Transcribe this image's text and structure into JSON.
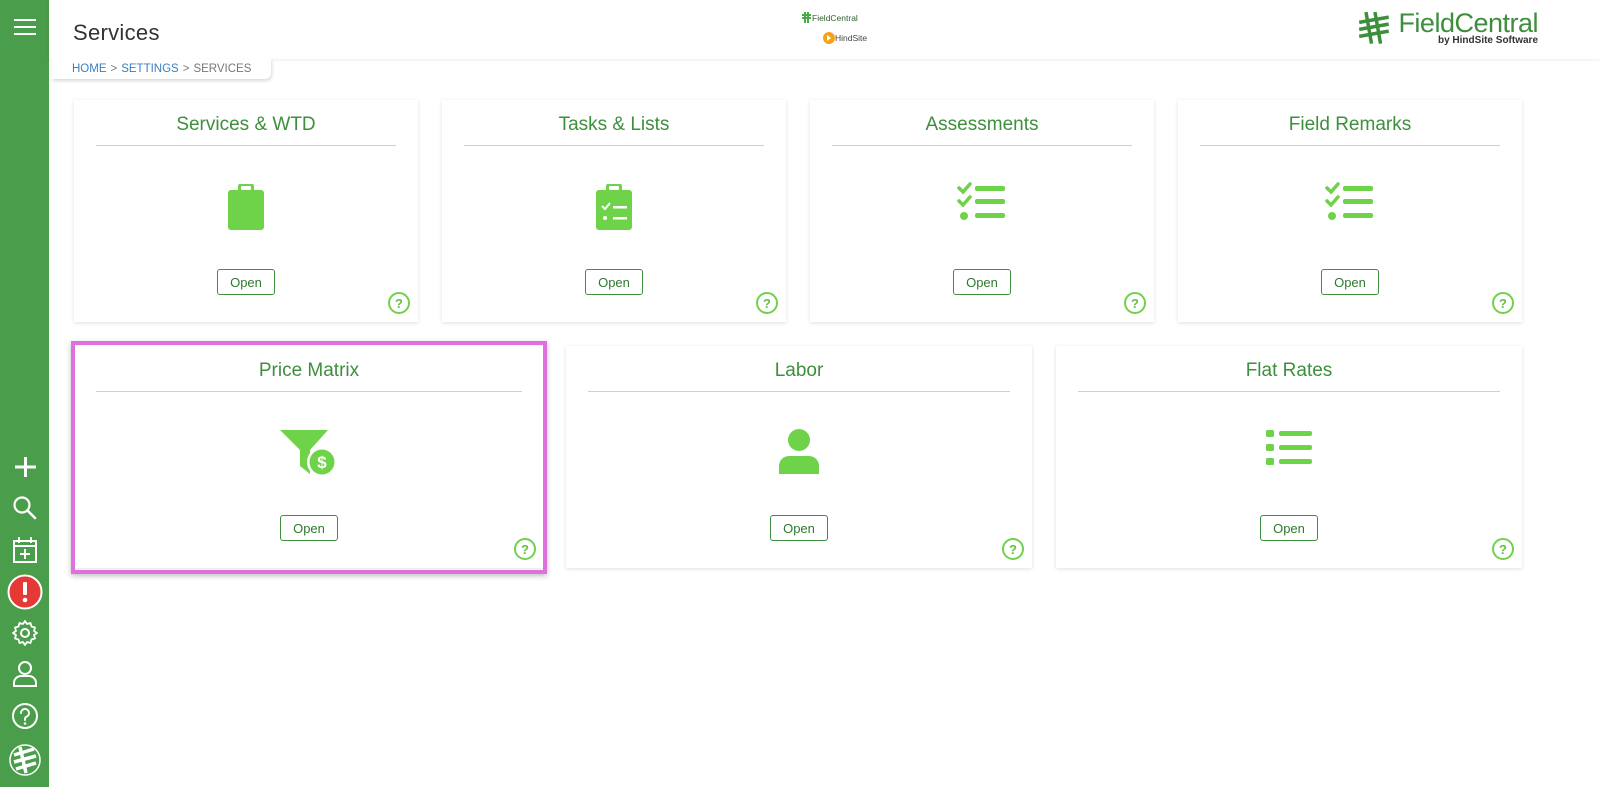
{
  "header": {
    "title": "Services",
    "breadcrumb": [
      {
        "label": "HOME"
      },
      {
        "label": "SETTINGS"
      },
      {
        "label": "SERVICES"
      }
    ],
    "breadcrumb_sep": ">",
    "center_logo": {
      "line1": "FieldCentral",
      "line2": "HindSite"
    },
    "brand": {
      "name": "FieldCentral",
      "tagline": "by HindSite Software"
    }
  },
  "cards": [
    {
      "title": "Services & WTD",
      "icon": "clipboard-icon",
      "button": "Open",
      "help": "?"
    },
    {
      "title": "Tasks & Lists",
      "icon": "clipboard-list-icon",
      "button": "Open",
      "help": "?"
    },
    {
      "title": "Assessments",
      "icon": "checklist-icon",
      "button": "Open",
      "help": "?"
    },
    {
      "title": "Field Remarks",
      "icon": "checklist-icon",
      "button": "Open",
      "help": "?"
    },
    {
      "title": "Price Matrix",
      "icon": "funnel-dollar-icon",
      "button": "Open",
      "help": "?"
    },
    {
      "title": "Labor",
      "icon": "user-icon",
      "button": "Open",
      "help": "?"
    },
    {
      "title": "Flat Rates",
      "icon": "list-icon",
      "button": "Open",
      "help": "?"
    }
  ],
  "sidebar": {
    "icons": [
      "menu-icon",
      "plus-icon",
      "search-icon",
      "calendar-add-icon",
      "alert-icon",
      "gear-icon",
      "user-icon",
      "help-icon",
      "logo-icon"
    ],
    "alert_glyph": "!"
  },
  "colors": {
    "sidebar": "#4a9d4a",
    "title_green": "#3d8f3d",
    "icon_green": "#6fd34a",
    "alert_red": "#e53935",
    "highlight": "#e070e0"
  }
}
